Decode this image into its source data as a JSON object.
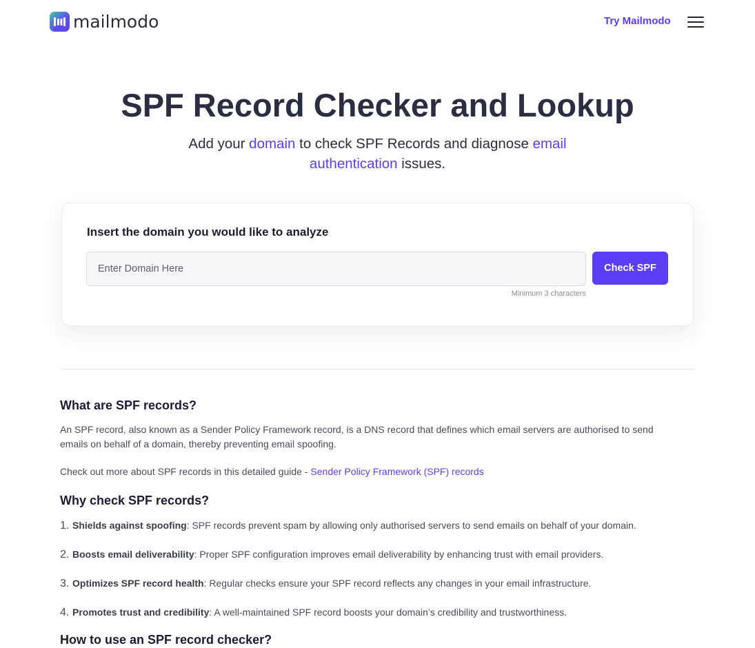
{
  "header": {
    "logo_text": "mailmodo",
    "try_link": "Try Mailmodo",
    "accent_color": "#5b3df5"
  },
  "hero": {
    "title": "SPF Record Checker and Lookup",
    "subtitle_part1": "Add your ",
    "subtitle_link1": "domain",
    "subtitle_part2": " to check SPF Records and diagnose ",
    "subtitle_link2": "email authentication",
    "subtitle_part3": " issues."
  },
  "checker": {
    "label": "Insert the domain you would like to analyze",
    "input_placeholder": "Enter Domain Here",
    "input_value": "",
    "button_label": "Check SPF",
    "hint": "Minimum 3 characters"
  },
  "section_what": {
    "heading": "What are SPF records?",
    "paragraph": "An SPF record, also known as a Sender Policy Framework record, is a DNS record that defines which email servers are authorised to send emails on behalf of a domain, thereby preventing email spoofing.",
    "guide_prefix": "Check out more about SPF records in this detailed guide - ",
    "guide_link": "Sender Policy Framework (SPF) records"
  },
  "section_why": {
    "heading": "Why check SPF records?",
    "items": [
      {
        "num": "1.",
        "title": "Shields against spoofing",
        "text": ": SPF records prevent spam by allowing only authorised servers to send emails on behalf of your domain."
      },
      {
        "num": "2.",
        "title": "Boosts email deliverability",
        "text": ": Proper SPF configuration improves email deliverability by enhancing trust with email providers."
      },
      {
        "num": "3.",
        "title": "Optimizes SPF record health",
        "text": ": Regular checks ensure your SPF record reflects any changes in your email infrastructure."
      },
      {
        "num": "4.",
        "title": "Promotes trust and credibility",
        "text": ": A well-maintained SPF record boosts your domain’s credibility and trustworthiness."
      }
    ]
  },
  "section_how": {
    "heading": "How to use an SPF record checker?"
  }
}
